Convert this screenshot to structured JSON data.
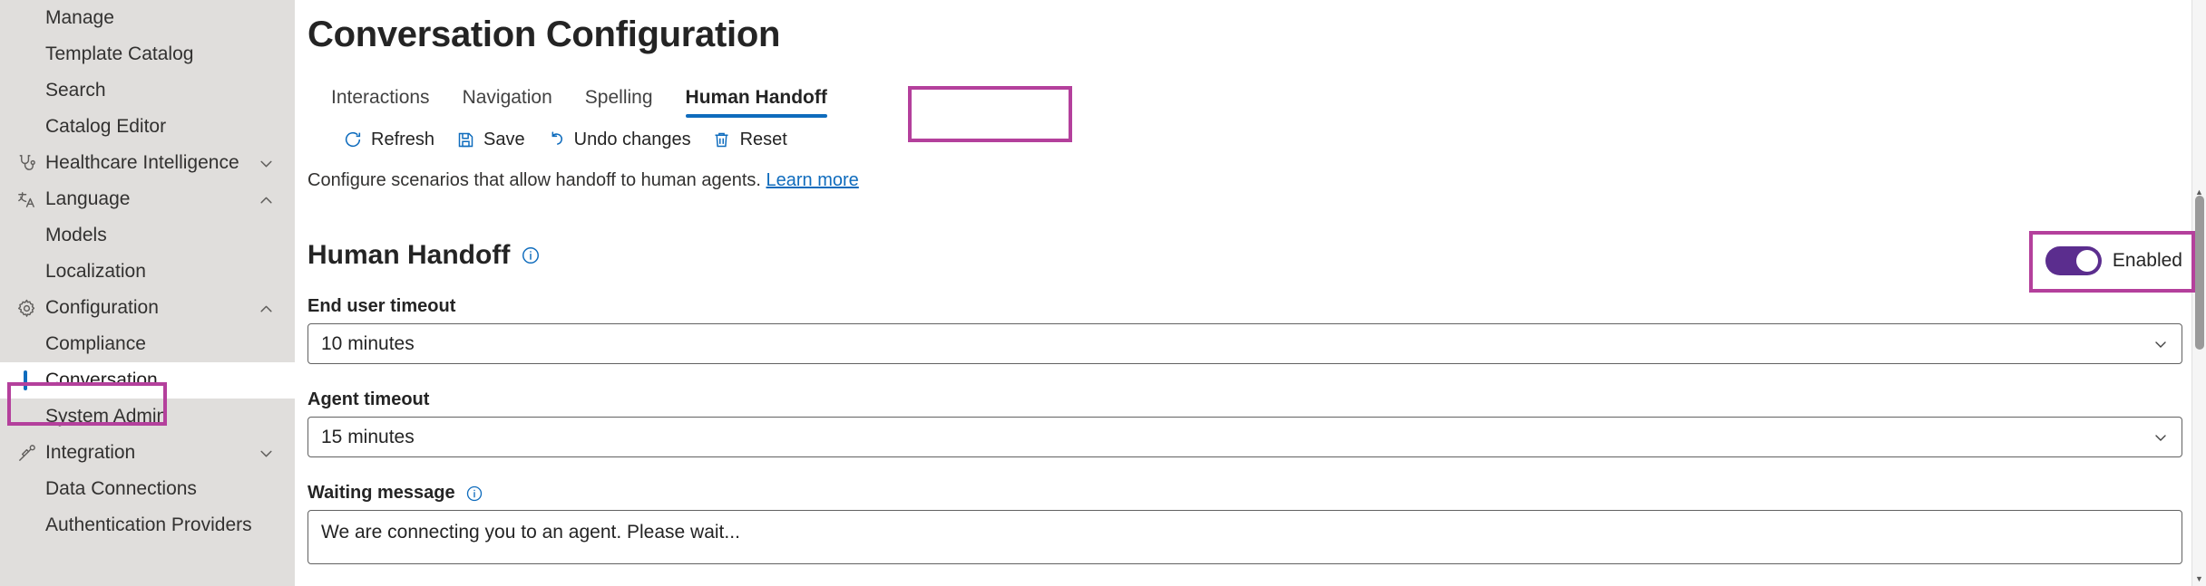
{
  "sidebar": {
    "items": [
      {
        "label": "Manage",
        "icon": "none",
        "level": "child",
        "chevron": "none",
        "selected": false
      },
      {
        "label": "Template Catalog",
        "icon": "none",
        "level": "child",
        "chevron": "none",
        "selected": false
      },
      {
        "label": "Search",
        "icon": "none",
        "level": "child",
        "chevron": "none",
        "selected": false
      },
      {
        "label": "Catalog Editor",
        "icon": "none",
        "level": "child",
        "chevron": "none",
        "selected": false
      },
      {
        "label": "Healthcare Intelligence",
        "icon": "stethoscope-icon",
        "level": "group",
        "chevron": "down",
        "selected": false
      },
      {
        "label": "Language",
        "icon": "translate-icon",
        "level": "group",
        "chevron": "up",
        "selected": false
      },
      {
        "label": "Models",
        "icon": "none",
        "level": "child",
        "chevron": "none",
        "selected": false
      },
      {
        "label": "Localization",
        "icon": "none",
        "level": "child",
        "chevron": "none",
        "selected": false
      },
      {
        "label": "Configuration",
        "icon": "gear-icon",
        "level": "group",
        "chevron": "up",
        "selected": false
      },
      {
        "label": "Compliance",
        "icon": "none",
        "level": "child",
        "chevron": "none",
        "selected": false
      },
      {
        "label": "Conversation",
        "icon": "none",
        "level": "child",
        "chevron": "none",
        "selected": true
      },
      {
        "label": "System Admin",
        "icon": "none",
        "level": "child",
        "chevron": "none",
        "selected": false
      },
      {
        "label": "Integration",
        "icon": "plug-icon",
        "level": "group",
        "chevron": "down",
        "selected": false
      },
      {
        "label": "Data Connections",
        "icon": "none",
        "level": "child",
        "chevron": "none",
        "selected": false
      },
      {
        "label": "Authentication Providers",
        "icon": "none",
        "level": "child",
        "chevron": "none",
        "selected": false
      }
    ]
  },
  "header": {
    "title": "Conversation Configuration"
  },
  "tabs": [
    {
      "label": "Interactions",
      "active": false
    },
    {
      "label": "Navigation",
      "active": false
    },
    {
      "label": "Spelling",
      "active": false
    },
    {
      "label": "Human Handoff",
      "active": true
    }
  ],
  "toolbar": {
    "refresh_label": "Refresh",
    "save_label": "Save",
    "undo_label": "Undo changes",
    "reset_label": "Reset"
  },
  "description": {
    "text": "Configure scenarios that allow handoff to human agents.",
    "link_label": "Learn more"
  },
  "enable_toggle": {
    "label": "Enabled",
    "state": "on"
  },
  "section": {
    "title": "Human Handoff"
  },
  "fields": {
    "end_user_timeout": {
      "label": "End user timeout",
      "value": "10 minutes"
    },
    "agent_timeout": {
      "label": "Agent timeout",
      "value": "15 minutes"
    },
    "waiting_message": {
      "label": "Waiting message",
      "value": "We are connecting you to an agent. Please wait..."
    }
  },
  "colors": {
    "accent_blue": "#0f6cbd",
    "annotation_magenta": "#b4409c",
    "toggle_purple": "#5b2d8e",
    "sidebar_gray": "#e0dedc"
  }
}
